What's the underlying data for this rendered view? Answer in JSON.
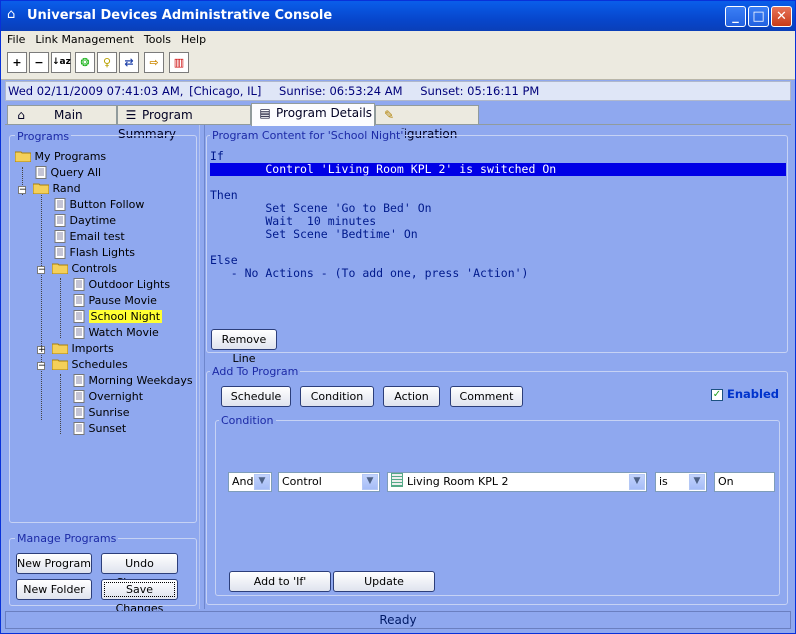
{
  "window": {
    "title": "Universal Devices Administrative Console"
  },
  "menu": [
    "File",
    "Link Management",
    "Tools",
    "Help"
  ],
  "toolbar_icons": [
    "expand-all-icon",
    "collapse-all-icon",
    "sort-az-icon",
    "network-icon",
    "light-bulb-icon",
    "link-icon",
    "export-icon",
    "chart-icon"
  ],
  "status": {
    "datetime": "Wed 02/11/2009 07:41:03 AM,",
    "location": "[Chicago, IL]",
    "sunrise": "Sunrise: 06:53:24 AM",
    "sunset": "Sunset: 05:16:11 PM"
  },
  "tabs": [
    {
      "label": "Main"
    },
    {
      "label": "Program Summary"
    },
    {
      "label": "Program Details"
    },
    {
      "label": "Configuration"
    }
  ],
  "programs": {
    "group_label": "Programs",
    "tree": {
      "root": "My Programs",
      "query_all": "Query All",
      "rand": "Rand",
      "button_follow": "Button Follow",
      "daytime": "Daytime",
      "email_test": "Email test",
      "flash_lights": "Flash Lights",
      "controls": "Controls",
      "outdoor_lights": "Outdoor Lights",
      "pause_movie": "Pause Movie",
      "school_night": "School Night",
      "watch_movie": "Watch Movie",
      "imports": "Imports",
      "schedules": "Schedules",
      "morning_weekdays": "Morning Weekdays",
      "overnight": "Overnight",
      "sunrise": "Sunrise",
      "sunset": "Sunset"
    }
  },
  "manage": {
    "label": "Manage Programs",
    "new_program": "New Program",
    "undo_changes": "Undo Changes",
    "new_folder": "New Folder",
    "save_changes": "Save Changes"
  },
  "content": {
    "label": "Program Content for 'School Night'",
    "if": "If",
    "if_line": "        Control 'Living Room KPL 2' is switched On",
    "then": "Then",
    "then_1": "        Set Scene 'Go to Bed' On",
    "then_2": "        Wait  10 minutes",
    "then_3": "        Set Scene 'Bedtime' On",
    "else": "Else",
    "else_1": "   - No Actions - (To add one, press 'Action')",
    "remove_line": "Remove Line"
  },
  "add": {
    "label": "Add To Program",
    "schedule": "Schedule",
    "condition": "Condition",
    "action": "Action",
    "comment": "Comment",
    "enabled": "Enabled",
    "condition_group": "Condition",
    "and_value": "And",
    "control_value": "Control",
    "device_value": "Living Room KPL 2",
    "is_value": "is",
    "on_value": "On",
    "add_to_if": "Add to 'If'",
    "update": "Update"
  },
  "statusbar": "Ready"
}
